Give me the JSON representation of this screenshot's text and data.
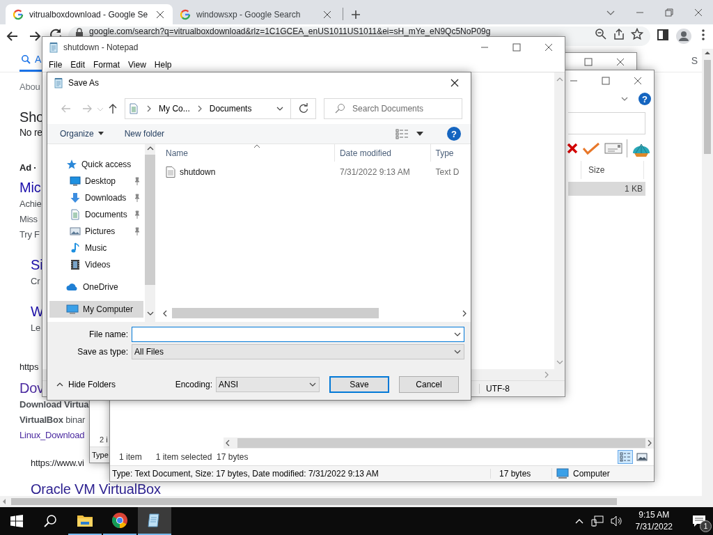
{
  "browser": {
    "tabs": [
      {
        "title": "vitrualboxdownload - Google Se",
        "selected": true
      },
      {
        "title": "windowsxp - Google Search",
        "selected": false
      }
    ],
    "url": "google.com/search?q=vitrualboxdownload&rlz=1C1GCEA_enUS1011US1011&ei=sH_mYe_eN9Qc5NoP09g",
    "search_tabs": [
      {
        "label": "A",
        "selected": true
      }
    ],
    "header_right": "S",
    "results": [
      {
        "kind": "meta",
        "text": "Abou"
      },
      {
        "kind": "title",
        "text": "Sho"
      },
      {
        "kind": "subtitle",
        "text": "No re"
      },
      {
        "kind": "ad-label",
        "text": "Ad ·"
      },
      {
        "kind": "ad-title",
        "text": "Mic"
      },
      {
        "kind": "text",
        "text": "Achie"
      },
      {
        "kind": "text",
        "text": "Miss"
      },
      {
        "kind": "text",
        "text": "Try F"
      },
      {
        "kind": "sitelink",
        "text": "Si"
      },
      {
        "kind": "sitelink-text",
        "text": "Cr"
      },
      {
        "kind": "sitelink",
        "text": "W"
      },
      {
        "kind": "sitelink-text",
        "text": "Le"
      },
      {
        "kind": "url",
        "text": "https"
      },
      {
        "kind": "result-title",
        "text": "Dov"
      },
      {
        "kind": "bold-text",
        "text": "Download Virtua"
      },
      {
        "kind": "text",
        "text": "**VirtualBox** binar"
      },
      {
        "kind": "link",
        "text": "Linux_Download"
      },
      {
        "kind": "sub-url",
        "text": "https://www.vi"
      },
      {
        "kind": "sub-title",
        "text": "Oracle VM VirtualBox"
      }
    ]
  },
  "back_window": {
    "line": "2 i",
    "status": "Type"
  },
  "explorer": {
    "help": "?",
    "column": "Size",
    "rows": [
      {
        "size": "1 KB",
        "selected": true
      }
    ],
    "count": "1 item",
    "selection": "1 item selected  17 bytes",
    "view_modes": [
      {
        "selected": true
      },
      {
        "selected": false
      }
    ],
    "details": "Type: Text Document, Size: 17 bytes, Date modified: 7/31/2022 9:13 AM",
    "size": "17 bytes",
    "location": "Computer"
  },
  "notepad": {
    "title": "shutdown - Notepad",
    "menu": [
      "File",
      "Edit",
      "Format",
      "View",
      "Help"
    ],
    "encoding": "UTF-8"
  },
  "save_dialog": {
    "title": "Save As",
    "breadcrumb": [
      "My Co...",
      "Documents"
    ],
    "search_placeholder": "Search Documents",
    "toolbar": [
      "Organize",
      "New folder"
    ],
    "help": "?",
    "nav": [
      {
        "label": "Quick access",
        "kind": "star",
        "selected": false,
        "children": [
          {
            "label": "Desktop",
            "kind": "desktop",
            "pinned": true,
            "selected": false
          },
          {
            "label": "Downloads",
            "kind": "download",
            "pinned": true,
            "selected": false
          },
          {
            "label": "Documents",
            "kind": "document",
            "pinned": true,
            "selected": false
          },
          {
            "label": "Pictures",
            "kind": "picture",
            "pinned": true,
            "selected": false
          },
          {
            "label": "Music",
            "kind": "music",
            "pinned": false,
            "selected": false
          },
          {
            "label": "Videos",
            "kind": "video",
            "pinned": false,
            "selected": false
          }
        ]
      },
      {
        "label": "OneDrive",
        "kind": "cloud",
        "selected": false
      },
      {
        "label": "My Computer",
        "kind": "computer",
        "selected": true
      }
    ],
    "columns": [
      "Name",
      "Date modified",
      "Type"
    ],
    "files": [
      {
        "name": "shutdown",
        "date": "7/31/2022 9:13 AM",
        "type": "Text D"
      }
    ],
    "file_name": {
      "label": "File name:",
      "focused": true
    },
    "save_as_type": {
      "label": "Save as type:",
      "value": "All Files"
    },
    "hide_folders": "Hide Folders",
    "encoding": {
      "label": "Encoding:",
      "value": "ANSI"
    },
    "buttons": [
      {
        "label": "Save",
        "default": true
      },
      {
        "label": "Cancel",
        "default": false
      }
    ]
  },
  "taskbar": {
    "apps": [
      {
        "kind": "explorer",
        "active": false
      },
      {
        "kind": "browser",
        "active": false
      },
      {
        "kind": "notepad",
        "active": true
      }
    ],
    "time": "9:15 AM",
    "date": "7/31/2022",
    "notifications": "1"
  }
}
